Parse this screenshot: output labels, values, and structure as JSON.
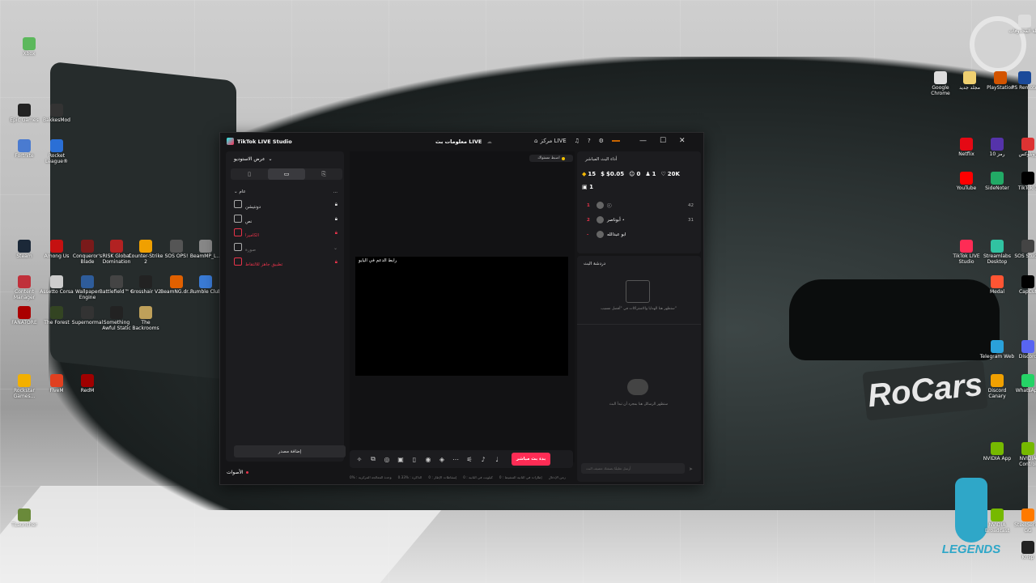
{
  "desktop": {
    "left_icons": [
      {
        "label": "Xbox",
        "color": "#5cb85c"
      },
      {
        "label": "Epic Games",
        "color": "#222222"
      },
      {
        "label": "BakkesMod",
        "color": "#333333"
      },
      {
        "label": "Fortnite",
        "color": "#4a7bd0"
      },
      {
        "label": "Rocket League®",
        "color": "#2a6fd6"
      },
      {
        "label": "Steam",
        "color": "#1b2838"
      },
      {
        "label": "Among Us",
        "color": "#c51111"
      },
      {
        "label": "Conqueror's Blade",
        "color": "#7a1a1a"
      },
      {
        "label": "RISK Global Domination",
        "color": "#b22222"
      },
      {
        "label": "Counter-Strike 2",
        "color": "#f0a000"
      },
      {
        "label": "SOS OPS!",
        "color": "#555555"
      },
      {
        "label": "BeamMP_L...",
        "color": "#888888"
      },
      {
        "label": "Content Manager",
        "color": "#c0303a"
      },
      {
        "label": "Assetto Corsa",
        "color": "#cccccc"
      },
      {
        "label": "Wallpaper Engine",
        "color": "#2e5c9a"
      },
      {
        "label": "Battlefield™ 6",
        "color": "#444444"
      },
      {
        "label": "Crosshair V2",
        "color": "#222222"
      },
      {
        "label": "BeamNG.dr...",
        "color": "#e06000"
      },
      {
        "label": "Rumble Club",
        "color": "#3a7bd5"
      },
      {
        "label": "FANATORE",
        "color": "#aa0000"
      },
      {
        "label": "The Forest",
        "color": "#334422"
      },
      {
        "label": "Supernormal",
        "color": "#333333"
      },
      {
        "label": "Something Awful Static",
        "color": "#222222"
      },
      {
        "label": "The Backrooms",
        "color": "#bfa05a"
      },
      {
        "label": "Rockstar Games...",
        "color": "#f3b000"
      },
      {
        "label": "FiveM",
        "color": "#e04020"
      },
      {
        "label": "RedM",
        "color": "#a00000"
      },
      {
        "label": "TLauncher",
        "color": "#6a8a3a"
      }
    ],
    "right_icons": [
      {
        "label": "سلة المحذوفات",
        "color": "#dddddd"
      },
      {
        "label": "Google Chrome",
        "color": "#dddddd"
      },
      {
        "label": "مجلد جديد",
        "color": "#f0d070"
      },
      {
        "label": "PlayStation",
        "color": "#d35400"
      },
      {
        "label": "PS Remote",
        "color": "#1a4a9a"
      },
      {
        "label": "Netflix",
        "color": "#e50914"
      },
      {
        "label": "رمز 10",
        "color": "#5533aa"
      },
      {
        "label": "روبلوكس",
        "color": "#dd3333"
      },
      {
        "label": "YouTube",
        "color": "#ff0000"
      },
      {
        "label": "SideNoter",
        "color": "#22aa66"
      },
      {
        "label": "TikTok 1",
        "color": "#000000"
      },
      {
        "label": "TikTok LIVE Studio",
        "color": "#fe2c55"
      },
      {
        "label": "Streamlabs Desktop",
        "color": "#31c3a2"
      },
      {
        "label": "SOS Studio",
        "color": "#444444"
      },
      {
        "label": "Medal",
        "color": "#ff5533"
      },
      {
        "label": "CapCut",
        "color": "#000000"
      },
      {
        "label": "Telegram Web",
        "color": "#2aa1da"
      },
      {
        "label": "Discord",
        "color": "#5865f2"
      },
      {
        "label": "Discord Canary",
        "color": "#f0a000"
      },
      {
        "label": "WhatsApp",
        "color": "#25d366"
      },
      {
        "label": "NVIDIA App",
        "color": "#76b900"
      },
      {
        "label": "NVIDIA Control",
        "color": "#76b900"
      },
      {
        "label": "NVIDIA Broadcast",
        "color": "#76b900"
      },
      {
        "label": "SteelSeries GG",
        "color": "#ff7a00"
      },
      {
        "label": "Krisp",
        "color": "#222222"
      }
    ],
    "plate_text": "RoCars",
    "legends_text": "LEGENDS"
  },
  "window": {
    "title": "TikTok LIVE Studio",
    "center_title": "معلومات بث LIVE",
    "live_center": "مركز LIVE",
    "controls": {
      "minimize": "—",
      "maximize": "☐",
      "close": "✕"
    }
  },
  "left_panel": {
    "studio_view": "عرض الاستوديو",
    "section": "عام",
    "more": "...",
    "sources": [
      {
        "label": "دونتيشن",
        "style": "normal",
        "icon": "globe-icon"
      },
      {
        "label": "نص",
        "style": "normal",
        "icon": "text-icon"
      },
      {
        "label": "الكاميرا",
        "style": "red",
        "icon": "camera-icon"
      },
      {
        "label": "صورة",
        "style": "dim",
        "icon": "image-icon"
      },
      {
        "label": "تطبيق جاهز للالتقاط",
        "style": "red",
        "icon": "app-capture-icon"
      }
    ],
    "add_source": "إضافة مصدر",
    "audio": "الأصوات"
  },
  "center": {
    "hint": "اضبط مستواك",
    "preview_label": "رابط الدعم في اليايو",
    "go_live": "بدء بث مباشر",
    "status": [
      "0% : وحدة المعالجة المركزية",
      "0.33% : الذاكرة",
      "0 : إسقاطات الإطار",
      "0 : كيلوبت في الثانية",
      "0 : إطارات في الثانية التنشيط",
      "زمن الإدخال"
    ]
  },
  "right_panel": {
    "perf_title": "أداء البث المباشر",
    "stats": [
      {
        "icon": "diamond-icon",
        "value": "15"
      },
      {
        "icon": "dollar-icon",
        "value": "$0.05"
      },
      {
        "icon": "viewers-icon",
        "value": "0"
      },
      {
        "icon": "person-icon",
        "value": "1"
      },
      {
        "icon": "heart-icon",
        "value": "20K"
      }
    ],
    "gift_box": {
      "icon": "gift-icon",
      "value": "1"
    },
    "ranking": [
      {
        "rank": "1",
        "name": "ⓘ",
        "count": "42"
      },
      {
        "rank": "2",
        "name": "أبوناصر ⋆",
        "count": "31"
      },
      {
        "rank": "-",
        "name": "ابو عبدالله",
        "count": ""
      }
    ],
    "chat_title": "دردشة البث",
    "gift_message": "ستظهر هنا الهدايا والاشتراكات في \"أفضل مسيب\"",
    "chat_message": "ستظهر الرسائل هنا بمجرد أن تبدأ البث",
    "chat_placeholder": "أرسل تعليقًا بصفتك مضيف البث"
  }
}
